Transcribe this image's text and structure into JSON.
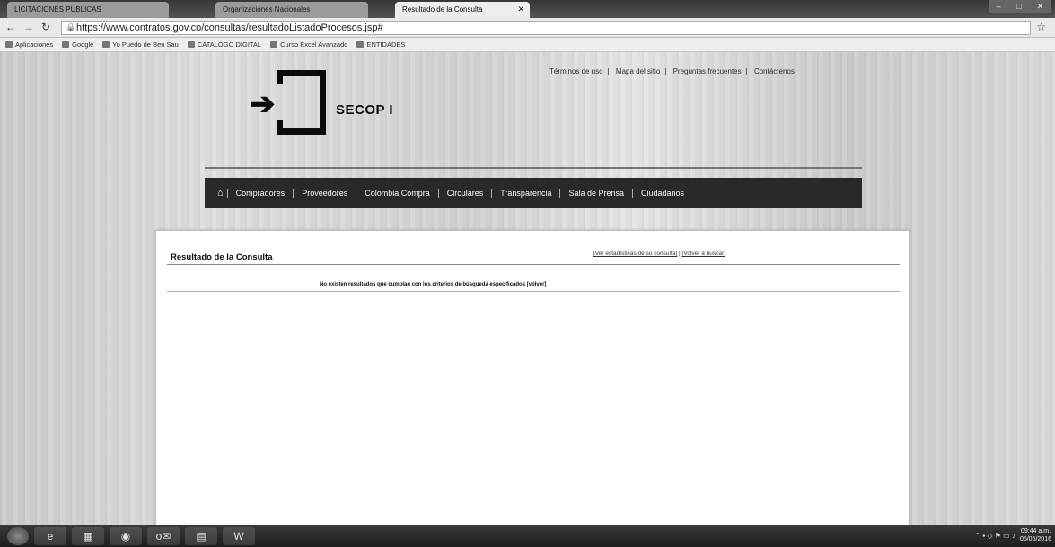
{
  "browser": {
    "tabs": [
      {
        "label": "LICITACIONES PUBLICAS",
        "active": false
      },
      {
        "label": "Organizaciones Nacionales",
        "active": false
      },
      {
        "label": "Resultado de la Consulta",
        "active": true
      }
    ],
    "url": "https://www.contratos.gov.co/consultas/resultadoListadoProcesos.jsp#",
    "bookmarks": [
      "Aplicaciones",
      "Google",
      "Yo Puedo de Ben Sau",
      "CATALOGO DIGITAL",
      "Curso Excel Avanzado",
      "ENTIDADES"
    ]
  },
  "site": {
    "top_links": [
      "Términos de uso",
      "Mapa del sitio",
      "Preguntas frecuentes",
      "Contáctenos"
    ],
    "logo_text": "SECOP I",
    "nav": [
      "Compradores",
      "Proveedores",
      "Colombia Compra",
      "Circulares",
      "Transparencia",
      "Sala de Prensa",
      "Ciudadanos"
    ]
  },
  "result": {
    "title": "Resultado de la Consulta",
    "link_criteria": "[Ver estadísticas de su consulta]",
    "link_back": "[Volver a buscar]",
    "message": "No existen resultados que cumplan con los criterios de búsqueda especificados [volver]"
  },
  "taskbar": {
    "time": "09:44 a.m.",
    "date": "05/05/2016"
  }
}
